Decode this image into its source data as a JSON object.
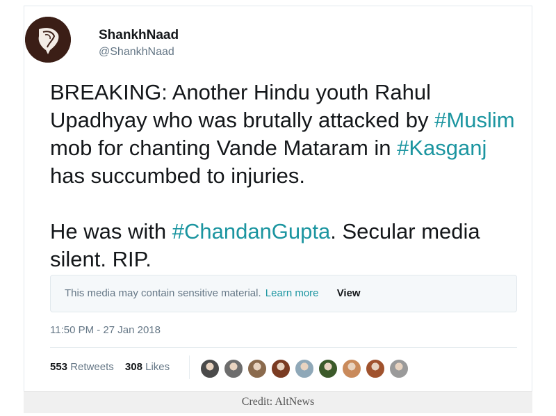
{
  "profile": {
    "avatar_icon": "conch-shell-logo",
    "display_name": "ShankhNaad",
    "handle": "@ShankhNaad"
  },
  "tweet": {
    "para1": {
      "t1": "BREAKING: Another Hindu youth Rahul Upadhyay who was brutally attacked by ",
      "tag1": "#Muslim",
      "t2": " mob for chanting Vande Mataram in ",
      "tag2": "#Kasganj",
      "t3": " has succumbed to injuries."
    },
    "para2": {
      "t1": "He was with ",
      "tag1": "#ChandanGupta",
      "t2": ". Secular media silent. RIP."
    },
    "hashtag_color": "#1b95a0"
  },
  "sensitive_notice": {
    "message": "This media may contain sensitive material.",
    "learn_more": "Learn more",
    "view": "View"
  },
  "timestamp": "11:50 PM - 27 Jan 2018",
  "stats": {
    "retweets_count": "553",
    "retweets_label": "Retweets",
    "likes_count": "308",
    "likes_label": "Likes"
  },
  "likers": [
    {
      "name": "liker-avatar-1",
      "color": "#4a4a4a"
    },
    {
      "name": "liker-avatar-2",
      "color": "#6d6d6d"
    },
    {
      "name": "liker-avatar-3",
      "color": "#8a6a4d"
    },
    {
      "name": "liker-avatar-4",
      "color": "#7a3b22"
    },
    {
      "name": "liker-avatar-5",
      "color": "#8fa8b8"
    },
    {
      "name": "liker-avatar-6",
      "color": "#3c5a2a"
    },
    {
      "name": "liker-avatar-7",
      "color": "#c98a5b"
    },
    {
      "name": "liker-avatar-8",
      "color": "#a0522d"
    },
    {
      "name": "liker-avatar-9",
      "color": "#9a9a9a"
    }
  ],
  "credit": "Credit: AltNews"
}
